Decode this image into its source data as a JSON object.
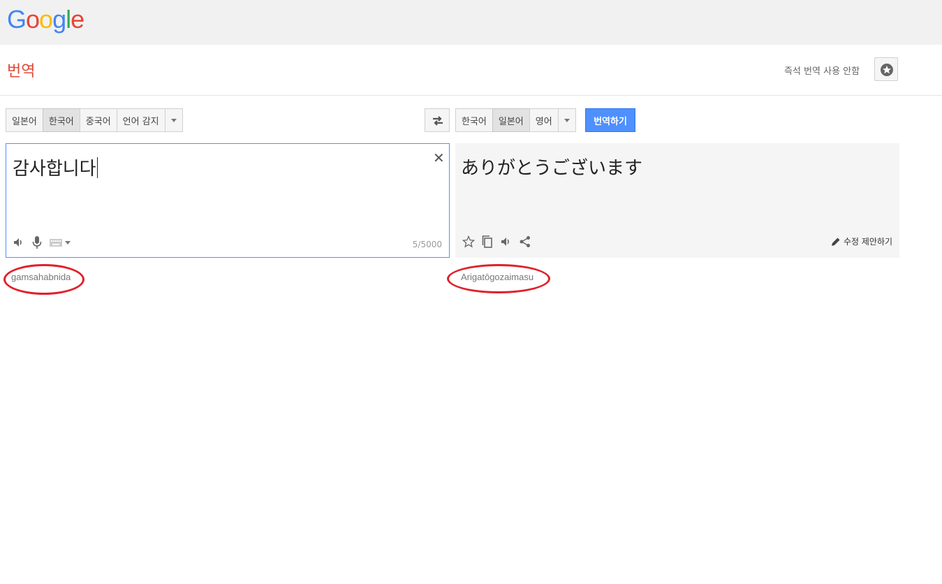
{
  "brand": {
    "letters": [
      {
        "ch": "G",
        "color": "#4285f4"
      },
      {
        "ch": "o",
        "color": "#ea4335"
      },
      {
        "ch": "o",
        "color": "#fbbc05"
      },
      {
        "ch": "g",
        "color": "#4285f4"
      },
      {
        "ch": "l",
        "color": "#34a853"
      },
      {
        "ch": "e",
        "color": "#ea4335"
      }
    ]
  },
  "header": {
    "title": "번역",
    "instant_toggle": "즉석 번역 사용 안함",
    "star_icon": "star-circle-icon"
  },
  "source": {
    "languages": [
      "일본어",
      "한국어",
      "중국어",
      "언어 감지"
    ],
    "selected": "한국어",
    "text": "감사합니다",
    "char_count": "5/5000",
    "clear_icon": "close-icon",
    "tools": [
      "speaker-icon",
      "microphone-icon",
      "keyboard-icon"
    ],
    "transliteration": "gamsahabnida"
  },
  "swap_icon": "swap-arrows-icon",
  "target": {
    "languages": [
      "한국어",
      "일본어",
      "영어"
    ],
    "selected": "일본어",
    "translate_button": "번역하기",
    "text": "ありがとうございます",
    "tools": [
      "star-icon",
      "copy-icon",
      "speaker-icon",
      "share-icon"
    ],
    "suggest_edit": "수정 제안하기",
    "transliteration": "Arigatōgozaimasu"
  },
  "colors": {
    "accent": "#4d90fe",
    "title_red": "#dd4b39",
    "highlight_ellipse": "#e0202a"
  }
}
